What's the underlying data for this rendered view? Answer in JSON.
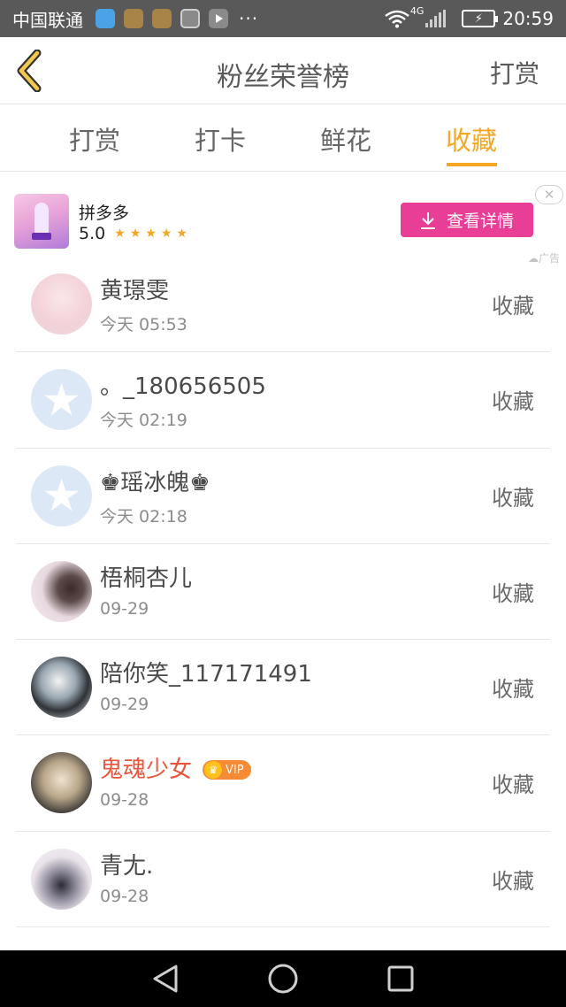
{
  "status_bar": {
    "carrier": "中国联通",
    "network": "4G",
    "time": "20:59",
    "more": "···"
  },
  "header": {
    "title": "粉丝荣誉榜",
    "right_action": "打赏",
    "back_icon": "chevron-left-icon",
    "accent": "#f5a623"
  },
  "tabs": [
    {
      "label": "打赏",
      "active": false
    },
    {
      "label": "打卡",
      "active": false
    },
    {
      "label": "鲜花",
      "active": false
    },
    {
      "label": "收藏",
      "active": true
    }
  ],
  "ad": {
    "app_name": "拼多多",
    "rating": "5.0",
    "stars": "★★★★★",
    "button_label": "查看详情",
    "label": "广告",
    "close": "✕",
    "button_color": "#e83e95"
  },
  "fans": [
    {
      "name": "黄璟雯",
      "time": "今天 05:53",
      "action": "收藏",
      "vip": false
    },
    {
      "name": "。_180656505",
      "time": "今天 02:19",
      "action": "收藏",
      "vip": false
    },
    {
      "name": "♚瑶冰魄♚",
      "time": "今天 02:18",
      "action": "收藏",
      "vip": false
    },
    {
      "name": "梧桐杏儿",
      "time": "09-29",
      "action": "收藏",
      "vip": false
    },
    {
      "name": "陪你笑_117171491",
      "time": "09-29",
      "action": "收藏",
      "vip": false
    },
    {
      "name": "鬼魂少女",
      "time": "09-28",
      "action": "收藏",
      "vip": true,
      "vip_label": "VIP"
    },
    {
      "name": "青尢.",
      "time": "09-28",
      "action": "收藏",
      "vip": false
    }
  ]
}
